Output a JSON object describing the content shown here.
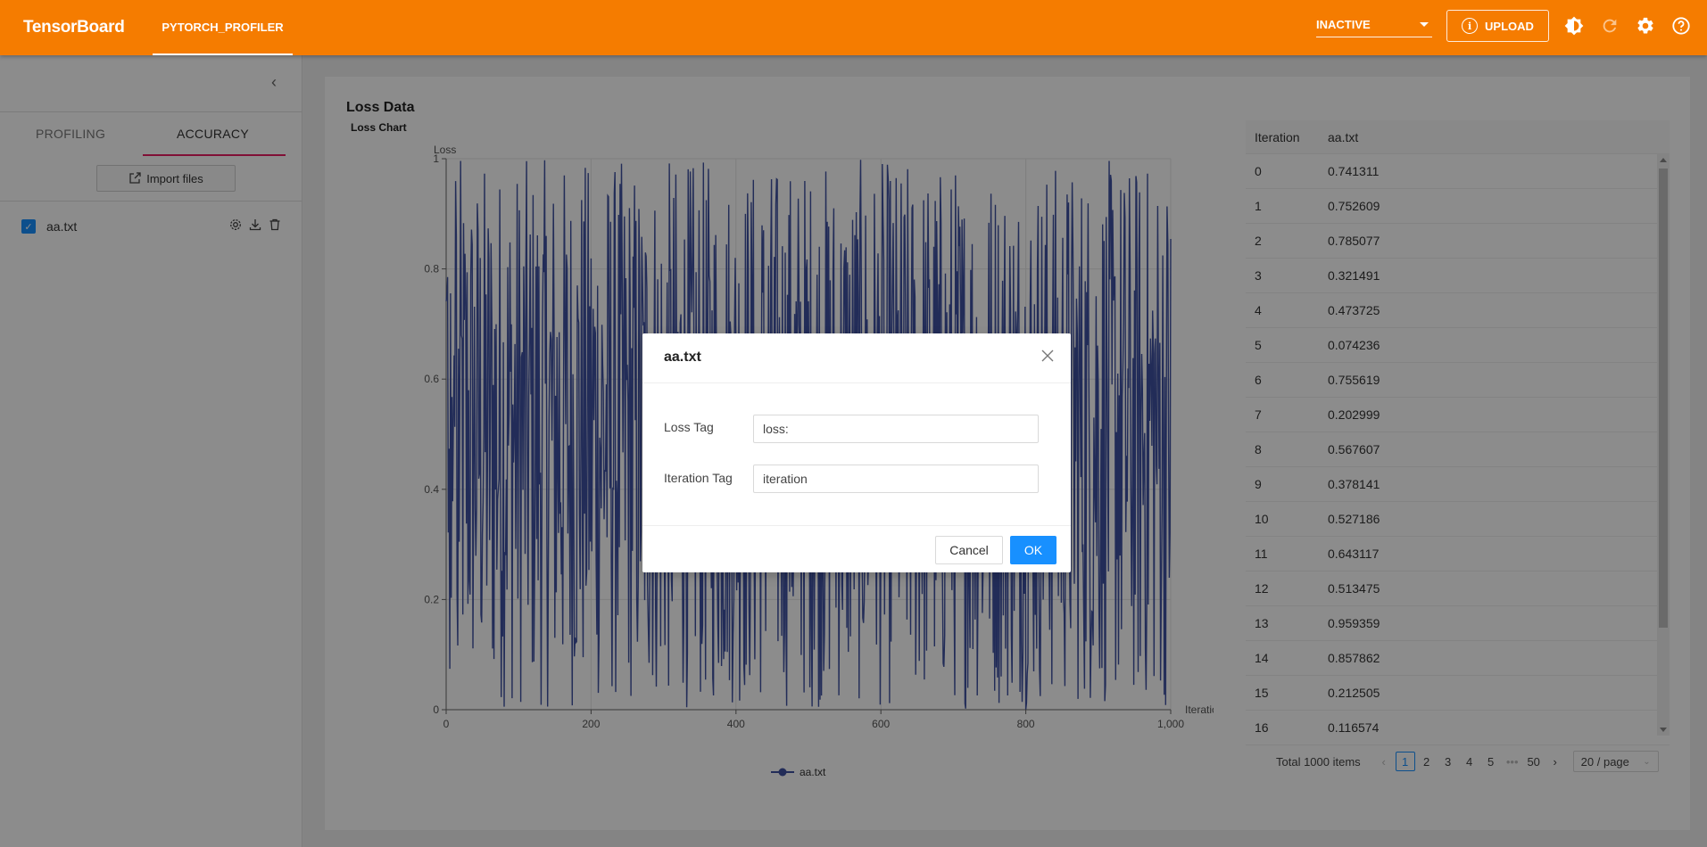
{
  "app": {
    "brand": "TensorBoard",
    "plugin_tab": "PYTORCH_PROFILER",
    "run_select": "INACTIVE",
    "upload_label": "UPLOAD"
  },
  "sidebar": {
    "tabs": [
      "PROFILING",
      "ACCURACY"
    ],
    "active_tab": "ACCURACY",
    "import_label": "Import files",
    "files": [
      {
        "name": "aa.txt",
        "checked": true
      }
    ]
  },
  "main": {
    "section_title": "Loss Data",
    "chart_title": "Loss Chart"
  },
  "chart_data": {
    "type": "line",
    "title": "Loss Chart",
    "xlabel": "Iteration",
    "ylabel": "Loss",
    "xlim": [
      0,
      1000
    ],
    "ylim": [
      0,
      1
    ],
    "x_ticks": [
      "0",
      "200",
      "400",
      "600",
      "800",
      "1,000"
    ],
    "y_ticks": [
      "0",
      "0.2",
      "0.4",
      "0.6",
      "0.8",
      "1"
    ],
    "grid": true,
    "legend": "bottom",
    "series": [
      {
        "name": "aa.txt",
        "color": "#3f51a0",
        "x": [
          0,
          1,
          2,
          3,
          4,
          5,
          6,
          7,
          8,
          9,
          10,
          11,
          12,
          13,
          14,
          15,
          16
        ],
        "values": [
          0.741311,
          0.752609,
          0.785077,
          0.321491,
          0.473725,
          0.074236,
          0.755619,
          0.202999,
          0.567607,
          0.378141,
          0.527186,
          0.643117,
          0.513475,
          0.959359,
          0.857862,
          0.212505,
          0.116574
        ],
        "note_points": 1000
      }
    ]
  },
  "table": {
    "headers": [
      "Iteration",
      "aa.txt"
    ],
    "rows": [
      [
        "0",
        "0.741311"
      ],
      [
        "1",
        "0.752609"
      ],
      [
        "2",
        "0.785077"
      ],
      [
        "3",
        "0.321491"
      ],
      [
        "4",
        "0.473725"
      ],
      [
        "5",
        "0.074236"
      ],
      [
        "6",
        "0.755619"
      ],
      [
        "7",
        "0.202999"
      ],
      [
        "8",
        "0.567607"
      ],
      [
        "9",
        "0.378141"
      ],
      [
        "10",
        "0.527186"
      ],
      [
        "11",
        "0.643117"
      ],
      [
        "12",
        "0.513475"
      ],
      [
        "13",
        "0.959359"
      ],
      [
        "14",
        "0.857862"
      ],
      [
        "15",
        "0.212505"
      ],
      [
        "16",
        "0.116574"
      ]
    ]
  },
  "pagination": {
    "total": "Total 1000 items",
    "pages": [
      "1",
      "2",
      "3",
      "4",
      "5",
      "•••",
      "50"
    ],
    "current": "1",
    "page_size": "20 / page"
  },
  "modal": {
    "title": "aa.txt",
    "loss_tag_label": "Loss Tag",
    "loss_tag_value": "loss:",
    "iteration_tag_label": "Iteration Tag",
    "iteration_tag_value": "iteration",
    "cancel_label": "Cancel",
    "ok_label": "OK"
  }
}
